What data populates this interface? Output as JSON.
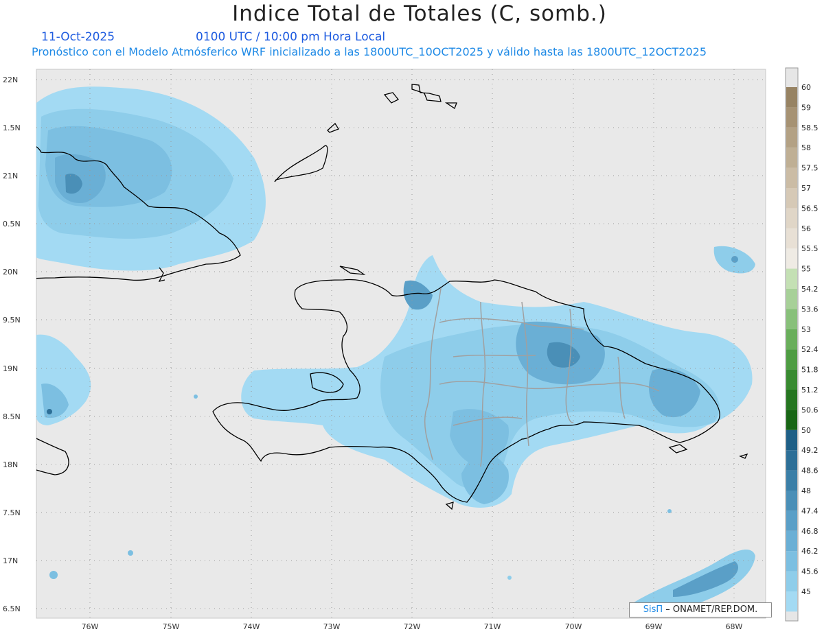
{
  "header": {
    "title": "Indice Total de Totales (C, somb.)",
    "date": "11-Oct-2025",
    "time_label": "0100 UTC / 10:00 pm Hora Local",
    "model_info": "Pronóstico con el Modelo Atmósferico WRF inicializado a las 1800UTC_10OCT2025 y válido hasta las  1800UTC_12OCT2025"
  },
  "map": {
    "lat_labels": [
      "22N",
      "1.5N",
      "21N",
      "0.5N",
      "20N",
      "9.5N",
      "19N",
      "8.5N",
      "18N",
      "7.5N",
      "17N",
      "6.5N"
    ],
    "lon_labels": [
      "76W",
      "75W",
      "74W",
      "73W",
      "72W",
      "71W",
      "70W",
      "69W",
      "68W"
    ],
    "background_color": "#e9e9e9",
    "coast_color": "#000000",
    "border_color": "#a0a0a0"
  },
  "colorbar": {
    "labels": [
      "60",
      "59",
      "58.5",
      "58",
      "57.5",
      "57",
      "56.5",
      "56",
      "55.5",
      "55",
      "54.2",
      "53.6",
      "53",
      "52.4",
      "51.8",
      "51.2",
      "50.6",
      "50",
      "49.2",
      "48.6",
      "48",
      "47.4",
      "46.8",
      "46.2",
      "45.6",
      "45"
    ],
    "colors": [
      "#978363",
      "#a69273",
      "#b3a184",
      "#bfaf94",
      "#cbbca5",
      "#d6c9b6",
      "#e0d6c7",
      "#e8e0d5",
      "#efebe4",
      "#c4e0b4",
      "#a7d098",
      "#88c07a",
      "#69ae5b",
      "#4e9c42",
      "#388a30",
      "#257520",
      "#186515",
      "#1e5f86",
      "#2d6f97",
      "#3b7fa7",
      "#4a8fb7",
      "#5a9fc7",
      "#6aafd5",
      "#7cbfe1",
      "#8ecdea",
      "#a3daf3"
    ]
  },
  "credit": {
    "prefix": "SisΠ",
    "text": " – ONAMET/REP.DOM."
  }
}
